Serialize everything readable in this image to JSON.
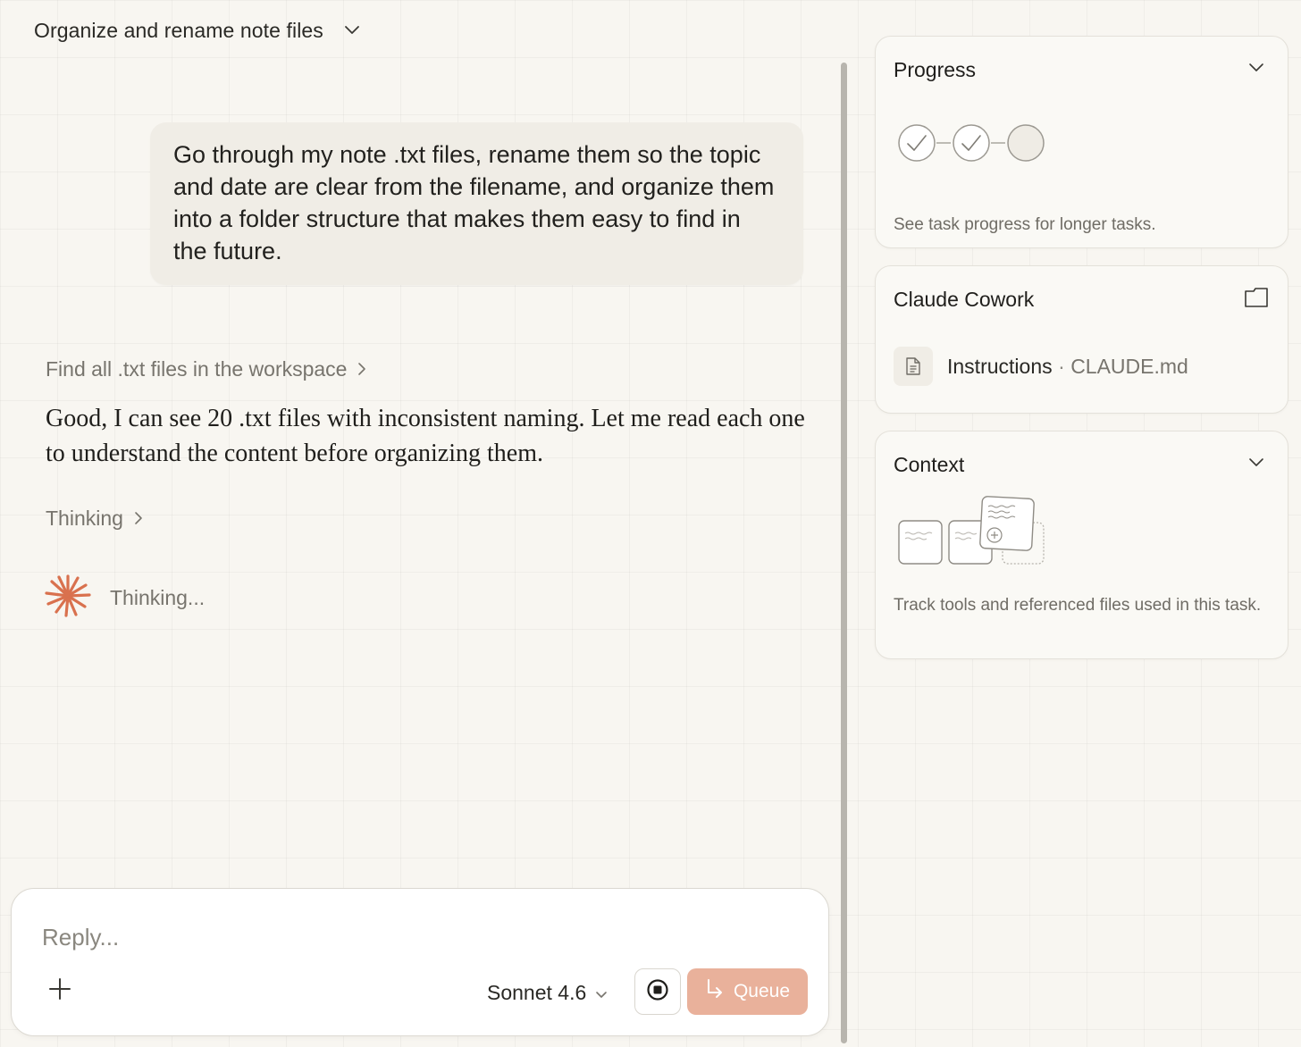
{
  "header": {
    "title": "Organize and rename note files"
  },
  "conversation": {
    "user_message": "Go through my note .txt files, rename them so the topic and date are clear from the filename, and organize them into a folder structure that makes them easy to find in the future.",
    "tool_find": "Find all .txt files in the workspace",
    "assistant_message": "Good, I can see 20 .txt files with inconsistent naming. Let me read each one to understand the content before organizing them.",
    "tool_thinking": "Thinking",
    "status_thinking": "Thinking..."
  },
  "composer": {
    "placeholder": "Reply...",
    "model": "Sonnet 4.6",
    "queue_label": "Queue"
  },
  "panel": {
    "progress": {
      "title": "Progress",
      "description": "See task progress for longer tasks.",
      "steps_completed": 2,
      "steps_total": 3
    },
    "cowork": {
      "title": "Claude Cowork",
      "instructions_label": "Instructions",
      "separator": "·",
      "instructions_file": "CLAUDE.md"
    },
    "context": {
      "title": "Context",
      "description": "Track tools and referenced files used in this task."
    }
  },
  "colors": {
    "accent": "#d9714e",
    "queue_button": "#e9b19b",
    "background": "#f8f6f1",
    "user_bubble": "#f0ede6"
  },
  "icons": {
    "header": "chevron-down-icon",
    "tool_expand": "chevron-right-icon",
    "spinner": "claude-spark-icon",
    "attach": "plus-icon",
    "stop": "stop-icon",
    "queue": "return-arrow-icon",
    "folder": "folder-icon",
    "document": "document-icon"
  }
}
